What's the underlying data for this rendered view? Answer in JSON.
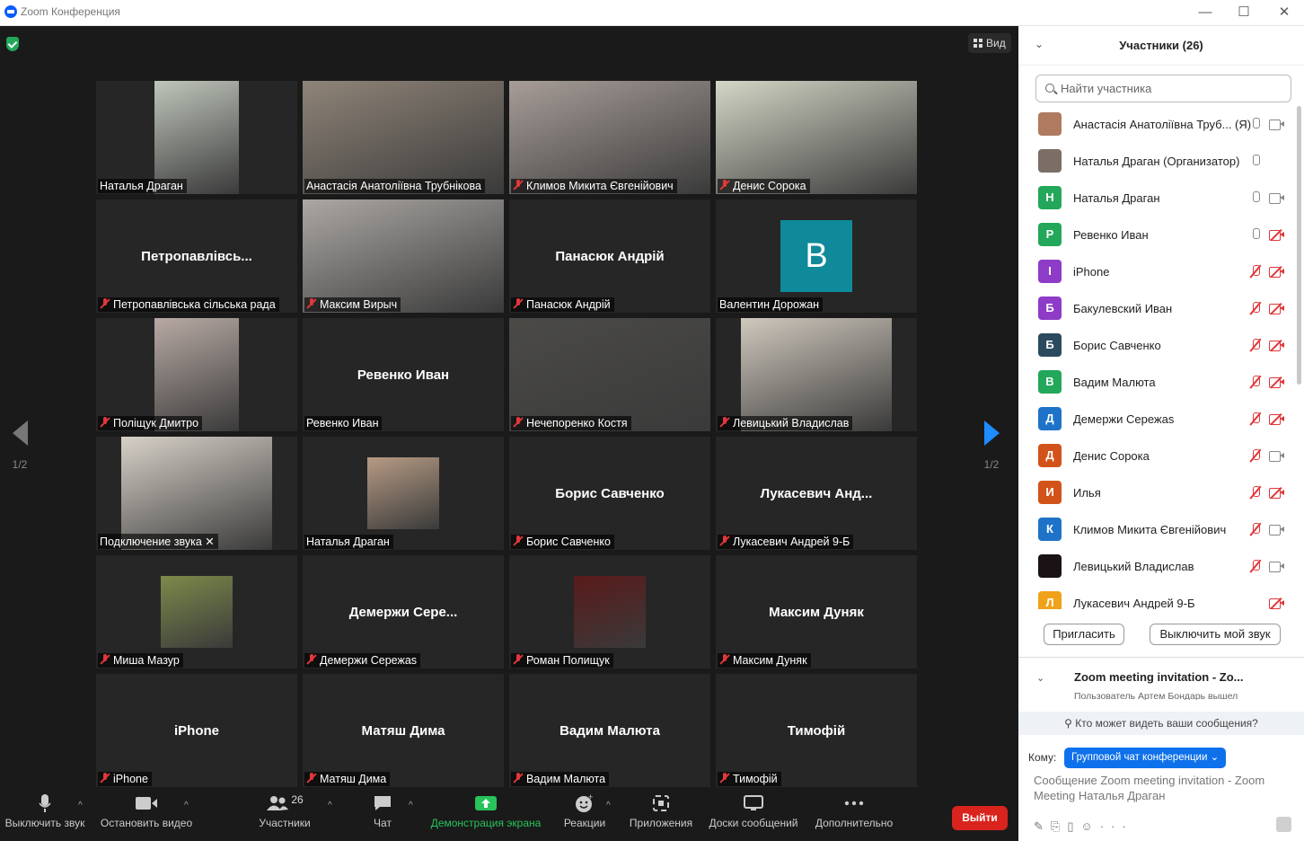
{
  "window": {
    "title": "Zoom Конференция"
  },
  "stage": {
    "view_label": "Вид",
    "page_left": "1/2",
    "page_right": "1/2"
  },
  "tiles": [
    {
      "label": "Наталья Драган",
      "muted": false,
      "video": true,
      "bg": "#bfc6bb"
    },
    {
      "label": "Анастасія Анатоліївна Трубнікова",
      "muted": false,
      "video": true,
      "bg": "#8f8478",
      "active": true
    },
    {
      "label": "Климов Микита Євгенійович",
      "muted": true,
      "video": true,
      "bg": "#a79d98"
    },
    {
      "label": "Денис Сорока",
      "muted": true,
      "video": true,
      "bg": "#d4d6c6"
    },
    {
      "big": "Петропавлівсь...",
      "label": "Петропавлівська сільська рада",
      "muted": true
    },
    {
      "label": "Максим Вирыч",
      "muted": true,
      "video": true,
      "bg": "#aba7a4"
    },
    {
      "big": "Панасюк Андрій",
      "label": "Панасюк Андрій",
      "muted": true
    },
    {
      "avatar": "В",
      "label": "Валентин Дорожан",
      "muted": false
    },
    {
      "label": "Поліщук Дмитро",
      "muted": true,
      "video": true,
      "bg": "#b8aaa4"
    },
    {
      "big": "Ревенко Иван",
      "label": "Ревенко Иван",
      "muted": false
    },
    {
      "label": "Нечепоренко Костя",
      "muted": true,
      "video": true,
      "bg": "#4b4a47"
    },
    {
      "label": "Левицький Владислав",
      "muted": true,
      "video": true,
      "bg": "#cfc8bd"
    },
    {
      "label": "Подключение звука ✕",
      "muted": false,
      "video": true,
      "bg": "#d7d1c8"
    },
    {
      "label": "Наталья Драган",
      "muted": false,
      "video": true,
      "bg": "#b69b84"
    },
    {
      "big": "Борис Савченко",
      "label": "Борис Савченко",
      "muted": true
    },
    {
      "big": "Лукасевич  Анд...",
      "label": "Лукасевич Андрей 9-Б",
      "muted": true
    },
    {
      "label": "Миша Мазур",
      "muted": true,
      "video": true,
      "bg": "#7c8a4a"
    },
    {
      "big": "Демержи  Сере...",
      "label": "Демержи Сережаѕ",
      "muted": true
    },
    {
      "label": "Роман Полищук",
      "muted": true,
      "video": true,
      "bg": "#5a1a1a"
    },
    {
      "big": "Максим Дуняк",
      "label": "Максим Дуняк",
      "muted": true
    },
    {
      "big": "iPhone",
      "label": "iPhone",
      "muted": true
    },
    {
      "big": "Матяш Дима",
      "label": "Матяш Дима",
      "muted": true
    },
    {
      "big": "Вадим Малюта",
      "label": "Вадим Малюта",
      "muted": true
    },
    {
      "big": "Тимофій",
      "label": "Тимофій",
      "muted": true
    }
  ],
  "toolbar": {
    "mute": "Выключить звук",
    "video": "Остановить видео",
    "participants": "Участники",
    "participants_count": "26",
    "chat": "Чат",
    "share": "Демонстрация экрана",
    "reactions": "Реакции",
    "apps": "Приложения",
    "boards": "Доски сообщений",
    "more": "Дополнительно",
    "leave": "Выйти"
  },
  "panel": {
    "title": "Участники (26)",
    "search_placeholder": "Найти участника",
    "invite": "Пригласить",
    "mute_me": "Выключить мой звук",
    "participants": [
      {
        "initial": "",
        "color": "#b07a60",
        "name": "Анастасія Анатоліївна Труб... (Я)",
        "mic": "on",
        "cam": "on"
      },
      {
        "initial": "",
        "color": "#7a6e66",
        "name": "Наталья Драган (Организатор)",
        "mic": "on",
        "cam": "none"
      },
      {
        "initial": "Н",
        "color": "#23a75a",
        "name": "Наталья Драган",
        "mic": "on",
        "cam": "on"
      },
      {
        "initial": "Р",
        "color": "#23a75a",
        "name": "Ревенко Иван",
        "mic": "on",
        "cam": "off"
      },
      {
        "initial": "I",
        "color": "#8e3bc8",
        "name": "iPhone",
        "mic": "off",
        "cam": "off"
      },
      {
        "initial": "Б",
        "color": "#8e3bc8",
        "name": "Бакулевский Иван",
        "mic": "off",
        "cam": "off"
      },
      {
        "initial": "Б",
        "color": "#2b4a5e",
        "name": "Борис Савченко",
        "mic": "off",
        "cam": "off"
      },
      {
        "initial": "В",
        "color": "#23a75a",
        "name": "Вадим Малюта",
        "mic": "off",
        "cam": "off"
      },
      {
        "initial": "Д",
        "color": "#1e73c8",
        "name": "Демержи Сережаѕ",
        "mic": "off",
        "cam": "off"
      },
      {
        "initial": "Д",
        "color": "#d2531a",
        "name": "Денис Сорока",
        "mic": "off",
        "cam": "on"
      },
      {
        "initial": "И",
        "color": "#d2531a",
        "name": "Илья",
        "mic": "off",
        "cam": "off"
      },
      {
        "initial": "К",
        "color": "#1e73c8",
        "name": "Климов Микита Євгенійович",
        "mic": "off",
        "cam": "on"
      },
      {
        "initial": "",
        "color": "#1a1214",
        "name": "Левицький Владислав",
        "mic": "off",
        "cam": "on"
      },
      {
        "initial": "Л",
        "color": "#f0a21a",
        "name": "Лукасевич Андрей 9-Б",
        "mic": "none",
        "cam": "off"
      }
    ]
  },
  "chat": {
    "title": "Zoom meeting invitation - Zo...",
    "system_line": "Пользователь Артем Бондарь вышел",
    "who_can_see": "Кто может видеть ваши сообщения?",
    "to_label": "Кому:",
    "to_value": "Групповой чат конференции ⌄",
    "message": "Сообщение Zoom meeting invitation - Zoom Meeting Наталья Драган"
  }
}
